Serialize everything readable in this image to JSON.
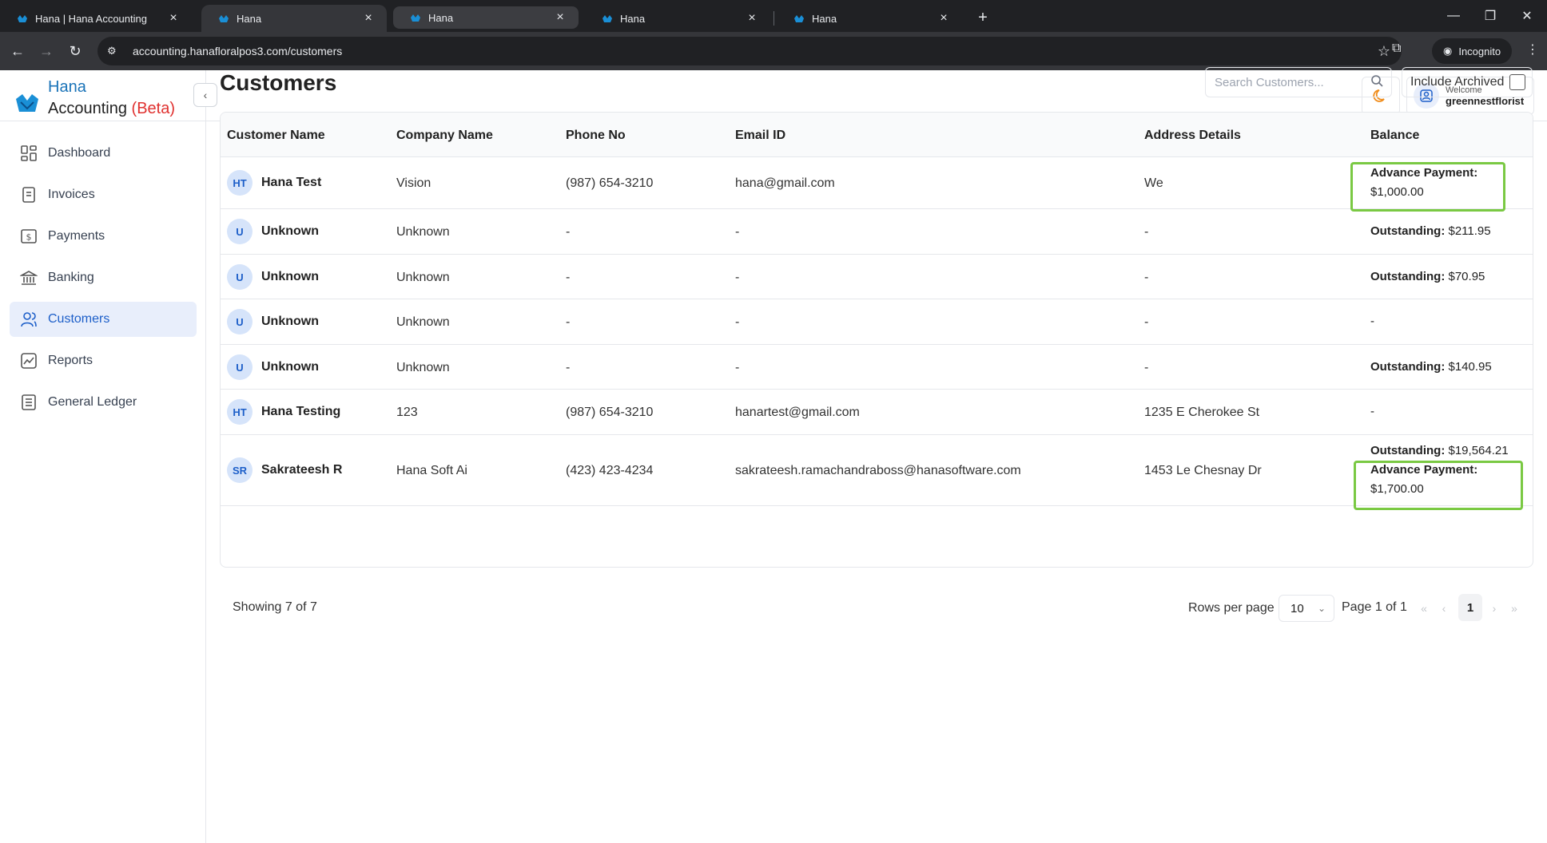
{
  "browser": {
    "tabs": [
      {
        "title": "Hana | Hana Accounting"
      },
      {
        "title": "Hana"
      },
      {
        "title": "Hana"
      },
      {
        "title": "Hana"
      },
      {
        "title": "Hana"
      }
    ],
    "url": "accounting.hanafloralpos3.com/customers",
    "profile_label": "Incognito"
  },
  "brand": {
    "name": "Hana",
    "subtitle": "Accounting",
    "badge": "(Beta)"
  },
  "sidebar": {
    "items": [
      {
        "label": "Dashboard",
        "icon": "dashboard-icon"
      },
      {
        "label": "Invoices",
        "icon": "invoice-icon"
      },
      {
        "label": "Payments",
        "icon": "dollar-icon"
      },
      {
        "label": "Banking",
        "icon": "bank-icon"
      },
      {
        "label": "Customers",
        "icon": "users-icon",
        "active": true
      },
      {
        "label": "Reports",
        "icon": "chart-icon"
      },
      {
        "label": "General Ledger",
        "icon": "ledger-icon"
      }
    ]
  },
  "header": {
    "welcome": "Welcome",
    "username": "greennestflorist"
  },
  "page": {
    "title": "Customers",
    "search_placeholder": "Search Customers...",
    "include_archived_label": "Include Archived"
  },
  "table": {
    "columns": [
      "Customer Name",
      "Company Name",
      "Phone No",
      "Email ID",
      "Address Details",
      "Balance"
    ],
    "rows": [
      {
        "initials": "HT",
        "name": "Hana Test",
        "company": "Vision",
        "phone": "(987) 654-3210",
        "email": "hana@gmail.com",
        "address": "We",
        "balance_label": "Advance Payment:",
        "balance_value": "$1,000.00"
      },
      {
        "initials": "U",
        "name": "Unknown",
        "company": "Unknown",
        "phone": "-",
        "email": "-",
        "address": "-",
        "balance_label": "Outstanding:",
        "balance_value": "$211.95"
      },
      {
        "initials": "U",
        "name": "Unknown",
        "company": "Unknown",
        "phone": "-",
        "email": "-",
        "address": "-",
        "balance_label": "Outstanding:",
        "balance_value": "$70.95"
      },
      {
        "initials": "U",
        "name": "Unknown",
        "company": "Unknown",
        "phone": "-",
        "email": "-",
        "address": "-",
        "balance_label": "",
        "balance_value": "-"
      },
      {
        "initials": "U",
        "name": "Unknown",
        "company": "Unknown",
        "phone": "-",
        "email": "-",
        "address": "-",
        "balance_label": "Outstanding:",
        "balance_value": "$140.95"
      },
      {
        "initials": "HT",
        "name": "Hana Testing",
        "company": "123",
        "phone": "(987) 654-3210",
        "email": "hanartest@gmail.com",
        "address": "1235 E Cherokee St",
        "balance_label": "",
        "balance_value": "-"
      },
      {
        "initials": "SR",
        "name": "Sakrateesh R",
        "company": "Hana Soft Ai",
        "phone": "(423) 423-4234",
        "email": "sakrateesh.ramachandraboss@hanasoftware.com",
        "address": "1453 Le Chesnay Dr",
        "balance_label": "Outstanding:",
        "balance_value": "$19,564.21",
        "balance_label_2": "Advance Payment:",
        "balance_value_2": "$1,700.00"
      }
    ]
  },
  "pagination": {
    "showing": "Showing 7 of 7",
    "rows_per_page_label": "Rows per page",
    "rows_per_page": "10",
    "page_of": "Page 1 of 1",
    "current_page": "1"
  },
  "colors": {
    "accent": "#1d5fc9",
    "brand": "#1a73b8",
    "beta": "#e0312f",
    "highlight": "#7ac943"
  }
}
